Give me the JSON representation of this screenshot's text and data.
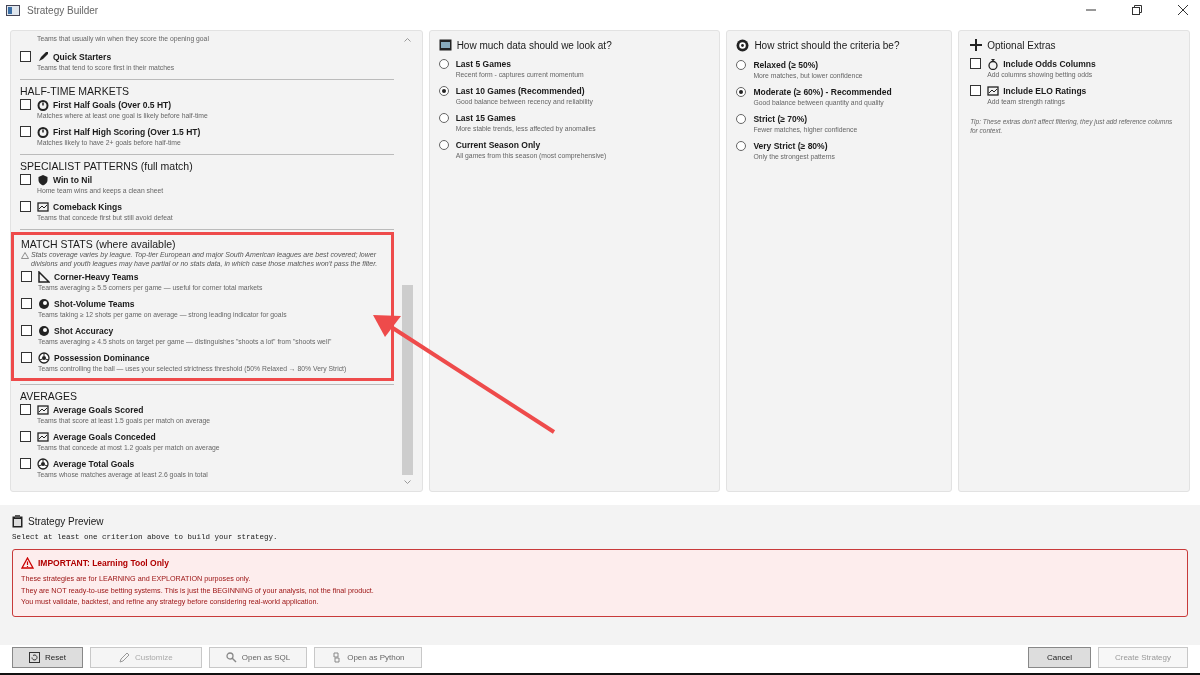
{
  "window": {
    "title": "Strategy Builder"
  },
  "criteria": {
    "cut_description": "Teams that usually win when they score the opening goal",
    "sections": [
      {
        "highlighted": false,
        "items": [
          {
            "label": "Quick Starters",
            "description": "Teams that tend to score first in their matches",
            "checked": false
          }
        ]
      },
      {
        "title": "HALF-TIME MARKETS",
        "highlighted": false,
        "items": [
          {
            "label": "First Half Goals (Over 0.5 HT)",
            "description": "Matches where at least one goal is likely before half-time",
            "checked": false
          },
          {
            "label": "First Half High Scoring (Over 1.5 HT)",
            "description": "Matches likely to have 2+ goals before half-time",
            "checked": false
          }
        ]
      },
      {
        "title": "SPECIALIST PATTERNS (full match)",
        "highlighted": false,
        "items": [
          {
            "label": "Win to Nil",
            "description": "Home team wins and keeps a clean sheet",
            "checked": false
          },
          {
            "label": "Comeback Kings",
            "description": "Teams that concede first but still avoid defeat",
            "checked": false
          }
        ]
      },
      {
        "title": "MATCH STATS (where available)",
        "highlighted": true,
        "note": "Stats coverage varies by league. Top-tier European and major South American leagues are best covered; lower divisions and youth leagues may have partial or no stats data, in which case those matches won't pass the filter.",
        "items": [
          {
            "label": "Corner-Heavy Teams",
            "description": "Teams averaging ≥ 5.5 corners per game — useful for corner total markets",
            "checked": false
          },
          {
            "label": "Shot-Volume Teams",
            "description": "Teams taking ≥ 12 shots per game on average — strong leading indicator for goals",
            "checked": false
          },
          {
            "label": "Shot Accuracy",
            "description": "Teams averaging ≥ 4.5 shots on target per game — distinguishes \"shoots a lot\" from \"shoots well\"",
            "checked": false
          },
          {
            "label": "Possession Dominance",
            "description": "Teams controlling the ball — uses your selected strictness threshold (50% Relaxed → 80% Very Strict)",
            "checked": false
          }
        ]
      },
      {
        "title": "AVERAGES",
        "highlighted": false,
        "items": [
          {
            "label": "Average Goals Scored",
            "description": "Teams that score at least 1.5 goals per match on average",
            "checked": false
          },
          {
            "label": "Average Goals Conceded",
            "description": "Teams that concede at most 1.2 goals per match on average",
            "checked": false
          },
          {
            "label": "Average Total Goals",
            "description": "Teams whose matches average at least 2.6 goals in total",
            "checked": false
          }
        ]
      }
    ]
  },
  "data_range": {
    "title": "How much data should we look at?",
    "options": [
      {
        "label": "Last 5 Games",
        "description": "Recent form - captures current momentum",
        "selected": false
      },
      {
        "label": "Last 10 Games (Recommended)",
        "description": "Good balance between recency and reliability",
        "selected": true
      },
      {
        "label": "Last 15 Games",
        "description": "More stable trends, less affected by anomalies",
        "selected": false
      },
      {
        "label": "Current Season Only",
        "description": "All games from this season (most comprehensive)",
        "selected": false
      }
    ]
  },
  "strictness": {
    "title": "How strict should the criteria be?",
    "options": [
      {
        "label": "Relaxed (≥ 50%)",
        "description": "More matches, but lower confidence",
        "selected": false
      },
      {
        "label": "Moderate (≥ 60%) - Recommended",
        "description": "Good balance between quantity and quality",
        "selected": true
      },
      {
        "label": "Strict (≥ 70%)",
        "description": "Fewer matches, higher confidence",
        "selected": false
      },
      {
        "label": "Very Strict (≥ 80%)",
        "description": "Only the strongest patterns",
        "selected": false
      }
    ]
  },
  "extras": {
    "title": "Optional Extras",
    "options": [
      {
        "label": "Include Odds Columns",
        "description": "Add columns showing betting odds",
        "checked": false
      },
      {
        "label": "Include ELO Ratings",
        "description": "Add team strength ratings",
        "checked": false
      }
    ],
    "tip": "Tip: These extras don't affect filtering, they just add reference columns for context."
  },
  "preview": {
    "title": "Strategy Preview",
    "message": "Select at least one criterion above to build your strategy.",
    "warning": {
      "title": "IMPORTANT: Learning Tool Only",
      "lines": [
        "These strategies are for LEARNING and EXPLORATION purposes only.",
        "They are NOT ready-to-use betting systems. This is just the BEGINNING of your analysis, not the final product.",
        "You must validate, backtest, and refine any strategy before considering real-world application."
      ]
    }
  },
  "buttons_left": [
    {
      "label": "Reset",
      "disabled": false
    },
    {
      "label": "Customize",
      "disabled": true
    },
    {
      "label": "Open as SQL",
      "disabled": false
    },
    {
      "label": "Open as Python",
      "disabled": false
    }
  ],
  "buttons_right": [
    {
      "label": "Cancel",
      "disabled": false
    },
    {
      "label": "Create Strategy",
      "disabled": true
    }
  ]
}
